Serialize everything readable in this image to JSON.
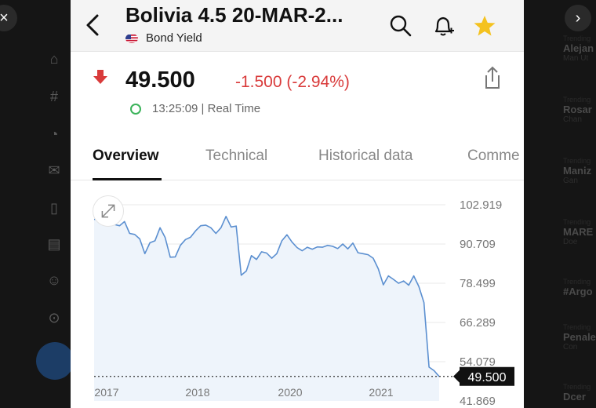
{
  "header": {
    "title": "Bolivia 4.5 20-MAR-2...",
    "subtitle": "Bond Yield",
    "icons": [
      "back-icon",
      "search-icon",
      "bell-plus-icon",
      "star-icon"
    ]
  },
  "quote": {
    "price": "49.500",
    "change": "-1.500 (-2.94%)",
    "time": "13:25:09 | Real Time",
    "direction": "down"
  },
  "tabs": [
    {
      "label": "Overview",
      "active": true
    },
    {
      "label": "Technical",
      "active": false
    },
    {
      "label": "Historical data",
      "active": false
    },
    {
      "label": "Comme",
      "active": false
    }
  ],
  "colors": {
    "negative": "#d93b3b",
    "line": "#5b8fd0",
    "fill": "#eef4fb",
    "star": "#f4c21f",
    "realtime": "#3bb35a"
  },
  "chart_data": {
    "type": "area",
    "x_ticks": [
      "2017",
      "2018",
      "2020",
      "2021"
    ],
    "y_ticks": [
      "102.919",
      "90.709",
      "78.499",
      "66.289",
      "54.079",
      "41.869"
    ],
    "ylim": [
      41.869,
      102.919
    ],
    "last_value": 49.5,
    "last_label": "49.500",
    "series": [
      {
        "values": [
          98.4,
          98.2,
          97.9,
          97.5,
          96.8,
          96.4,
          97.7,
          94.0,
          93.7,
          92.3,
          87.7,
          91.1,
          91.7,
          95.8,
          92.7,
          86.6,
          86.7,
          90.3,
          92.1,
          92.8,
          94.8,
          96.4,
          96.6,
          95.8,
          94.0,
          95.8,
          99.3,
          96.0,
          96.3,
          81.0,
          82.3,
          87.1,
          85.9,
          88.3,
          87.9,
          86.3,
          87.7,
          91.7,
          93.6,
          91.3,
          89.6,
          88.6,
          89.7,
          89.1,
          89.8,
          89.7,
          90.3,
          90.0,
          89.3,
          90.7,
          89.2,
          91.0,
          88.0,
          87.7,
          87.4,
          86.3,
          83.0,
          78.0,
          80.8,
          79.7,
          78.5,
          79.2,
          77.9,
          80.8,
          77.5,
          72.5,
          52.4,
          51.3,
          49.5
        ]
      }
    ]
  },
  "right_sidebar": [
    {
      "small": "Trending",
      "name": "Alejan",
      "sub": "Man Ut"
    },
    {
      "small": "Trending",
      "name": "Rosar",
      "sub": "Chan"
    },
    {
      "small": "Trending",
      "name": "Maniz",
      "sub": "Gan"
    },
    {
      "small": "Trending",
      "name": "MARE",
      "sub": "Doe"
    },
    {
      "small": "Trending",
      "name": "#Argo",
      "sub": ""
    },
    {
      "small": "Trending",
      "name": "Penale",
      "sub": "Con"
    },
    {
      "small": "Trending",
      "name": "Dcer",
      "sub": ""
    }
  ]
}
